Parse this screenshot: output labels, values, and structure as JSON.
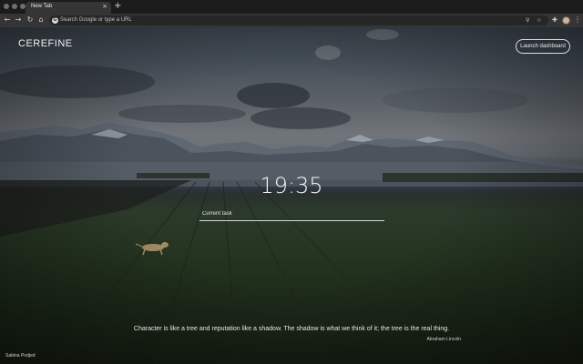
{
  "browser": {
    "tab_title": "New Tab",
    "tab_close_glyph": "×",
    "new_tab_glyph": "+",
    "back_glyph": "←",
    "forward_glyph": "→",
    "reload_glyph": "↻",
    "home_glyph": "⌂",
    "omnibox_placeholder": "Search Google or type a URL",
    "omnibox_google_glyph": "G",
    "zoom_glyph": "⚲",
    "star_glyph": "☆",
    "extensions_glyph": "✚",
    "menu_glyph": "⋮"
  },
  "page": {
    "brand": "CEREFINE",
    "launch_label": "Launch dashboard",
    "clock": "19:35",
    "task_placeholder": "Current task",
    "quote": "Character is like a tree and reputation like a shadow. The shadow is what we think of it; the tree is the real thing.",
    "author": "Abraham Lincoln",
    "photo_credit": "Sabina Podjed"
  },
  "icons": {
    "back": "arrow-left-icon",
    "forward": "arrow-right-icon",
    "reload": "reload-icon",
    "home": "home-icon",
    "google": "google-icon",
    "zoom": "zoom-icon",
    "star": "bookmark-star-icon",
    "extensions": "puzzle-icon",
    "menu": "kebab-menu-icon"
  }
}
